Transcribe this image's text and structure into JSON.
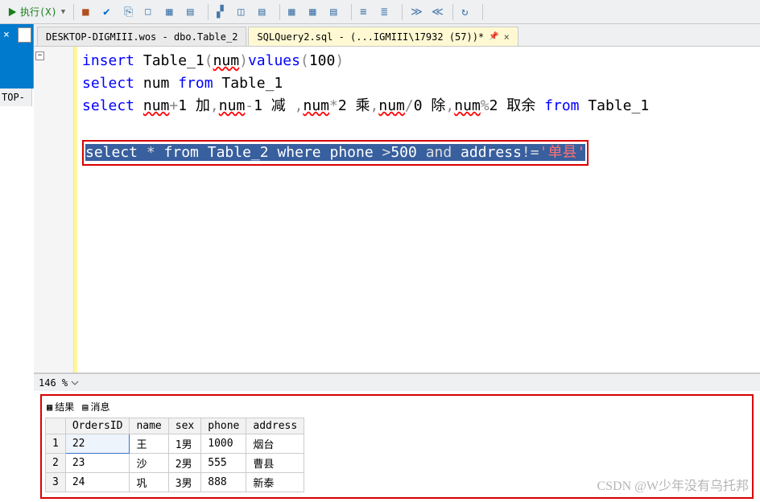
{
  "toolbar": {
    "execute_label": "执行(X)"
  },
  "side": {
    "close": "×",
    "label": "TOP-"
  },
  "tabs": [
    {
      "label": "DESKTOP-DIGMIII.wos - dbo.Table_2",
      "active": false
    },
    {
      "label": "SQLQuery2.sql - (...IGMIII\\17932 (57))*",
      "active": true
    }
  ],
  "code": {
    "line1": {
      "kw1": "insert",
      "t1": " Table_1",
      "p1": "(",
      "arg": "num",
      "p2": ")",
      "kw2": "values",
      "p3": "(",
      "val": "100",
      "p4": ")"
    },
    "line2": {
      "kw1": "select",
      "c1": " num ",
      "kw2": "from",
      "t1": " Table_1"
    },
    "line3": {
      "kw1": "select",
      "s1": "  ",
      "a1": "num",
      "o1": "+",
      "n1": "1 加",
      "c1": ",",
      "a2": "num",
      "o2": "-",
      "n2": "1 减 ",
      "c2": ",",
      "a3": "num",
      "o3": "*",
      "n3": "2 乘",
      "c3": ",",
      "a4": "num",
      "o4": "/",
      "n4": "0 除",
      "c4": ",",
      "a5": "num",
      "o5": "%",
      "n5": "2 取余 ",
      "kw2": "from",
      "t1": " Table_1"
    },
    "line5": {
      "kw1": "select",
      "star": " * ",
      "kw2": "from",
      "t": " Table_2 ",
      "kw3": "where",
      "ph": " phone ",
      "op1": ">",
      "v1": "500 ",
      "kw4": "and",
      "ad": " address",
      "op2": "!=",
      "str": "'单县'"
    }
  },
  "zoom": "146 %",
  "results": {
    "tabs": {
      "results": "结果",
      "messages": "消息"
    },
    "cols": [
      "",
      "OrdersID",
      "name",
      "sex",
      "phone",
      "address"
    ],
    "rows": [
      {
        "n": "1",
        "c": [
          "22",
          "王",
          "1男",
          "1000",
          "烟台"
        ]
      },
      {
        "n": "2",
        "c": [
          "23",
          "沙",
          "2男",
          "555",
          "曹县"
        ]
      },
      {
        "n": "3",
        "c": [
          "24",
          "巩",
          "3男",
          "888",
          "新泰"
        ]
      }
    ]
  },
  "watermark": "CSDN @W少年没有乌托邦"
}
